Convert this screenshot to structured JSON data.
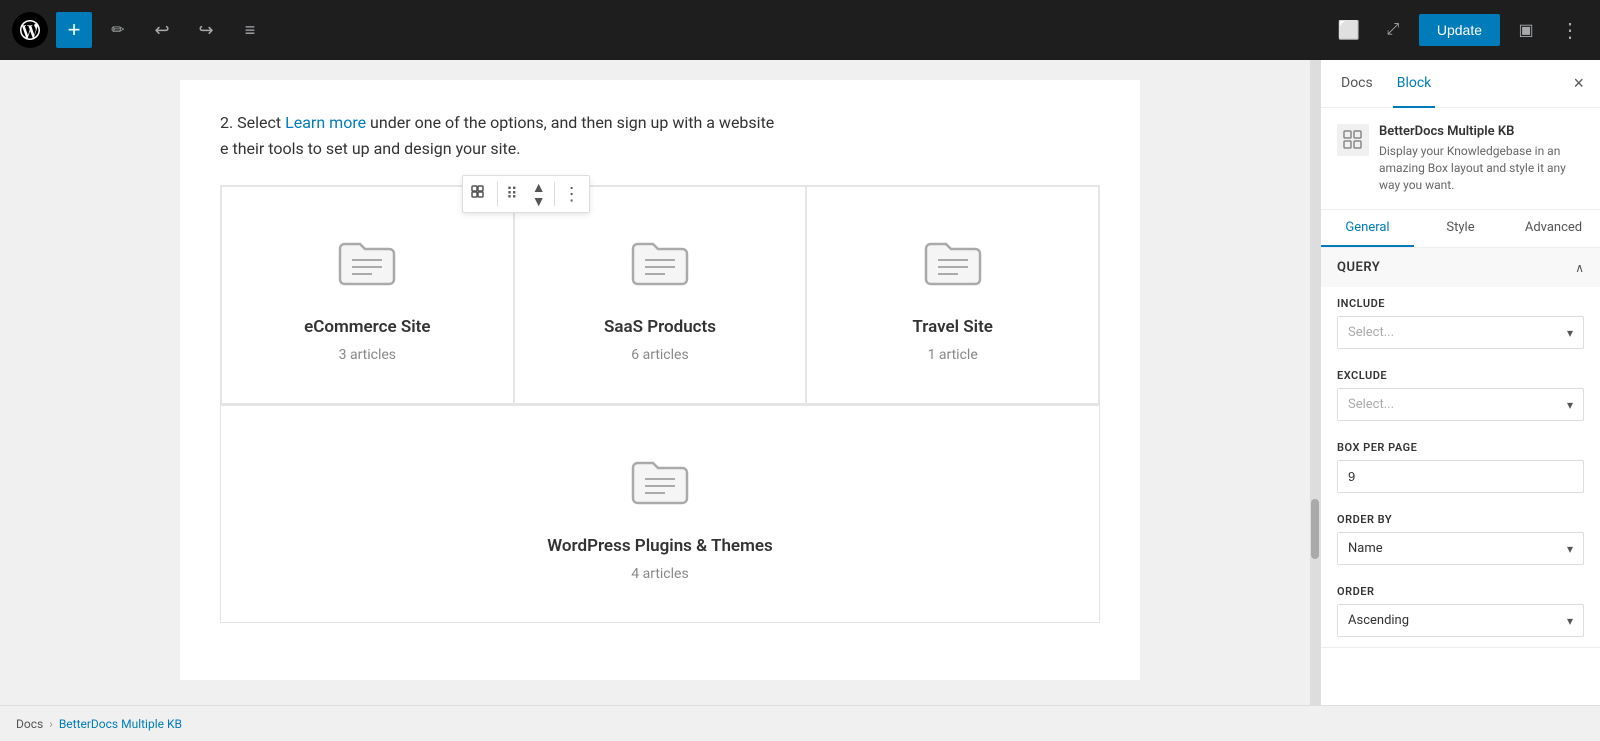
{
  "toolbar": {
    "add_label": "+",
    "update_label": "Update",
    "pencil_icon": "✏",
    "undo_icon": "↩",
    "redo_icon": "↪",
    "menu_icon": "≡",
    "monitor_icon": "□",
    "external_icon": "⤢",
    "sidebar_icon": "▣",
    "kebab_icon": "⋮"
  },
  "editor": {
    "text_before_link": "2. Select ",
    "link_text": "Learn more",
    "text_after_link": " under one of the options, and then sign up with a website",
    "text_line2": "e their tools to set up and design your site."
  },
  "kb_cards": [
    {
      "title": "eCommerce Site",
      "count": "3 articles"
    },
    {
      "title": "SaaS Products",
      "count": "6 articles"
    },
    {
      "title": "Travel Site",
      "count": "1 article"
    },
    {
      "title": "WordPress Plugins &amp; Themes",
      "count": "4 articles"
    }
  ],
  "sidebar": {
    "tab_docs": "Docs",
    "tab_block": "Block",
    "plugin_title": "BetterDocs Multiple KB",
    "plugin_desc": "Display your Knowledgebase in an amazing Box layout and style it any way you want.",
    "tab_general": "General",
    "tab_style": "Style",
    "tab_advanced": "Advanced",
    "section_query": "Query",
    "section_query_open": true,
    "include_label": "INCLUDE",
    "include_placeholder": "Select...",
    "exclude_label": "EXCLUDE",
    "exclude_placeholder": "Select...",
    "box_per_page_label": "BOX PER PAGE",
    "box_per_page_value": "9",
    "order_by_label": "ORDER BY",
    "order_by_value": "Name",
    "order_label": "ORDER",
    "order_value": "Ascending",
    "close_icon": "×"
  },
  "breadcrumb": {
    "items": [
      {
        "label": "Docs",
        "active": false
      },
      {
        "label": "BetterDocs Multiple KB",
        "active": true
      }
    ]
  }
}
